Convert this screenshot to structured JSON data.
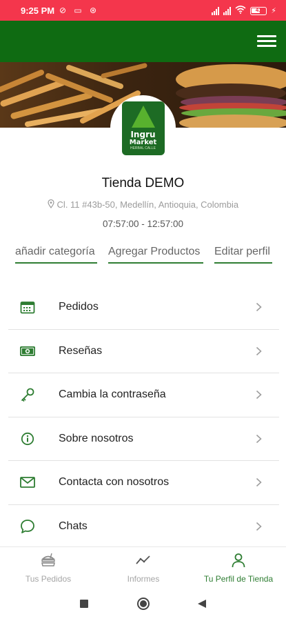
{
  "status_bar": {
    "time": "9:25 PM",
    "battery_level": "41",
    "color": "#f4364c"
  },
  "app_bar": {
    "color": "#0f6b12",
    "menu_icon": "hamburger-menu-icon"
  },
  "banner": {
    "image": "fries-and-burger-photo"
  },
  "logo": {
    "line1": "Ingru",
    "line2": "Market",
    "line3": "HERBAL CALLE"
  },
  "store": {
    "name": "Tienda DEMO",
    "address": "Cl. 11 #43b-50, Medellín, Antioquia, Colombia",
    "hours": "07:57:00 - 12:57:00"
  },
  "actions": {
    "add_category": "añadir categoría",
    "add_products": "Agregar Productos",
    "edit_profile": "Editar perfil"
  },
  "menu": {
    "items": [
      {
        "label": "Pedidos",
        "icon": "calendar-icon"
      },
      {
        "label": "Reseñas",
        "icon": "money-icon"
      },
      {
        "label": "Cambia la contraseña",
        "icon": "key-icon"
      },
      {
        "label": "Sobre nosotros",
        "icon": "info-icon"
      },
      {
        "label": "Contacta con nosotros",
        "icon": "mail-icon"
      },
      {
        "label": "Chats",
        "icon": "chat-bubble-icon"
      }
    ]
  },
  "bottom_nav": {
    "items": [
      {
        "label": "Tus Pedidos",
        "icon": "food-orders-icon"
      },
      {
        "label": "Informes",
        "icon": "chart-line-icon"
      },
      {
        "label": "Tu Perfil de Tienda",
        "icon": "person-icon"
      }
    ],
    "active_color": "#2e7d32",
    "inactive_color": "#a5a5a5"
  },
  "accent_color": "#2e7d32"
}
